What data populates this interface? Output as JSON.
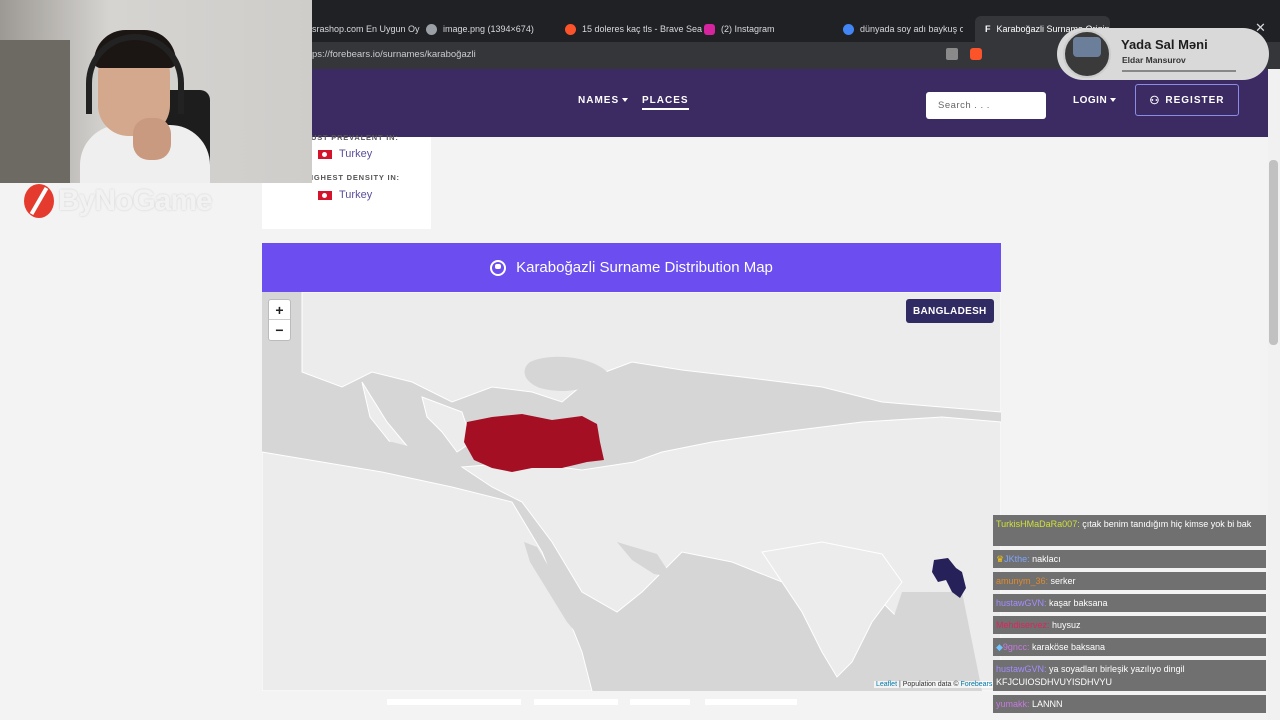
{
  "browser": {
    "tabs": [
      {
        "label": "srashop.com En Uygun Oy",
        "icon": "store-icon",
        "color": "#4a7bd0"
      },
      {
        "label": "image.png (1394×674)",
        "icon": "globe-icon",
        "color": "#9aa0a6"
      },
      {
        "label": "15 doleres kaç tls - Brave Sea",
        "icon": "brave-icon",
        "color": "#fb542b"
      },
      {
        "label": "(2) Instagram",
        "icon": "instagram-icon",
        "color": "#d6249f"
      },
      {
        "label": "dünyada soy adı baykuş olan",
        "icon": "google-icon",
        "color": "#4285f4"
      },
      {
        "label": "Karaboğazli Surname Origin",
        "icon": "forebears-icon",
        "color": "#ffffff"
      }
    ],
    "url": "ps://forebears.io/surnames/karaboğazli",
    "window_controls": {
      "close": "✕"
    }
  },
  "header": {
    "nav_names": "NAMES",
    "nav_places": "PLACES",
    "search_placeholder": "Search . . .",
    "login": "LOGIN",
    "register": "REGISTER",
    "bg_color": "#3c2a63"
  },
  "info_card": {
    "prevalent_label": "UST PREVALENT IN:",
    "prevalent_value": "Turkey",
    "density_label": "IGHEST DENSITY IN:",
    "density_value": "Turkey"
  },
  "map_section": {
    "title": "Karaboğazli Surname Distribution Map",
    "zoom_in": "+",
    "zoom_out": "−",
    "badge": "BANGLADESH",
    "attribution_leaflet": "Leaflet",
    "attribution_text": " | Population data © ",
    "attribution_source": "Forebears",
    "header_color": "#6b4df0",
    "highlight_color": "#a50f24",
    "hover_color": "#27215a"
  },
  "overlay": {
    "brand": "ByNoGame",
    "now_playing": {
      "title": "Yada Sal Məni",
      "artist": "Eldar Mansurov"
    }
  },
  "chat": [
    {
      "user": "TurkisHMaDaRa007:",
      "text": " çıtak benim tanıdığım hiç kimse yok bi bak",
      "color": "#cfe03a"
    },
    {
      "user": "JKthe:",
      "text": " naklacı",
      "color": "#7ea5ff"
    },
    {
      "user": "amunym_36:",
      "text": " serker",
      "color": "#e08a2c"
    },
    {
      "user": "hustawGVN:",
      "text": " kaşar baksana",
      "color": "#a58cff"
    },
    {
      "user": "Mehdiservez:",
      "text": " huysuz",
      "color": "#e0245e"
    },
    {
      "user": "9gncc:",
      "text": " karaköse baksana",
      "color": "#c678e0"
    },
    {
      "user": "hustawGVN:",
      "text": " ya soyadları birleşik yazılıyo dingil KFJCUIOSDHVUYISDHVYU",
      "color": "#a58cff"
    },
    {
      "user": "yumakk:",
      "text": " LANNN",
      "color": "#c678e0"
    }
  ]
}
